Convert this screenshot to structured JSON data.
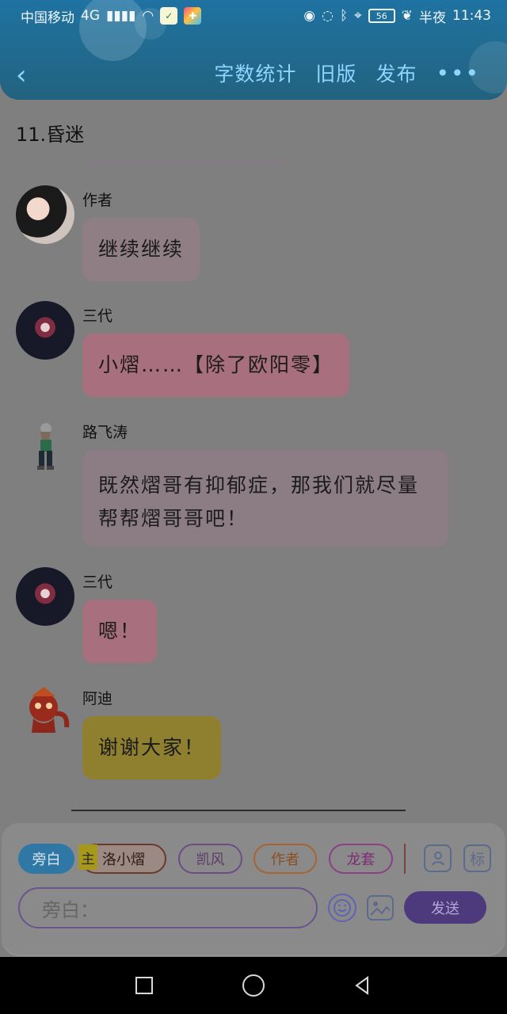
{
  "status_bar": {
    "carrier": "中国移动",
    "network": "4G",
    "battery": "56",
    "time_label": "半夜",
    "time": "11:43"
  },
  "header": {
    "back_icon": "back-icon",
    "actions": [
      "字数统计",
      "旧版",
      "发布"
    ],
    "more_icon": "more-icon"
  },
  "chapter_title": "11.昏迷",
  "messages": [
    {
      "name": "作者",
      "text": "继续继续",
      "bubble_color": "#8f7e84",
      "avatar": "avatar-author"
    },
    {
      "name": "三代",
      "text": "小熠……【除了欧阳零】",
      "bubble_color": "#a86f7e",
      "avatar": "avatar-sandai"
    },
    {
      "name": "路飞涛",
      "text": "既然熠哥有抑郁症，那我们就尽量帮帮熠哥哥吧！",
      "bubble_color": "#8c7c84",
      "avatar": "avatar-lu"
    },
    {
      "name": "三代",
      "text": "嗯！",
      "bubble_color": "#a86f7e",
      "avatar": "avatar-sandai"
    },
    {
      "name": "阿迪",
      "text": "谢谢大家！",
      "bubble_color": "#8f8030",
      "avatar": "avatar-adi"
    }
  ],
  "composer": {
    "chips": [
      "旁白",
      "洛小熠",
      "凯风",
      "作者",
      "龙套"
    ],
    "main_badge": "主",
    "side_icon_1": "person-icon",
    "side_icon_2": "标",
    "input_placeholder": "旁白：",
    "send_label": "发送"
  },
  "nav": {
    "square_icon": "square-icon",
    "home_icon": "circle-icon",
    "back_icon": "triangle-back-icon"
  },
  "colors": {
    "accent": "#1f73a2",
    "purple": "#4c3a7d",
    "pink": "#a86f7e",
    "yellow": "#8f8030"
  }
}
